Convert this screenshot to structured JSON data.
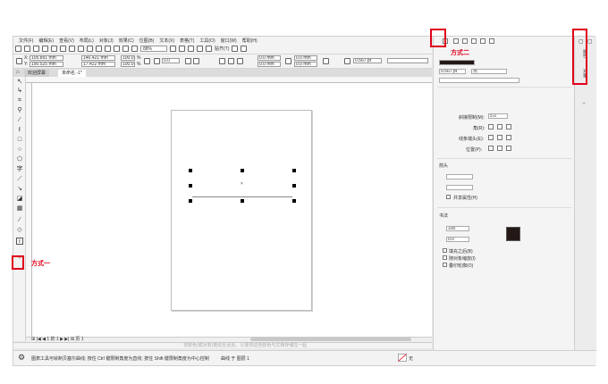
{
  "menu": [
    "文件(F)",
    "编辑(E)",
    "查看(V)",
    "布局(L)",
    "对象(J)",
    "效果(C)",
    "位图(B)",
    "文本(X)",
    "表格(T)",
    "工具(O)",
    "窗口(W)",
    "帮助(H)"
  ],
  "toolbar": {
    "zoom_value": "88%",
    "snap_label": "贴齐(T)"
  },
  "propbar": {
    "x_label": "X:",
    "x_value": "105.891 mm",
    "y_label": "Y:",
    "y_value": "190.525 mm",
    "w_value": "146.421 mm",
    "h_value": "17.422 mm",
    "sx_value": "100.0",
    "sy_value": "100.0",
    "pct": "%",
    "rotation": "0.0",
    "pos1": "0.0 mm",
    "pos2": "0.0 mm",
    "outline1": "0.0 mm",
    "outline2": "0.0 mm",
    "stroke": "0.567 pt"
  },
  "tabs": {
    "welcome": "欢迎屏幕",
    "doc": "未命名 -1*"
  },
  "pagenav": {
    "page_label": "页 1"
  },
  "palette_hint": "将颜色(或对象)拖动至此处，以便将这些颜色与文档存储在一起",
  "status": {
    "text": "图表工具可绘制贝塞尔曲线; 按住 Ctrl 键限制角度为直线; 按住 Shift 键限制角度为中心控制",
    "layer": "曲线 于 图层 1",
    "fill_none": "无"
  },
  "docker": {
    "stroke_width": "0.567 pt",
    "unit": "点",
    "miter_label": "斜接限制(M):",
    "miter_value": "5.0",
    "corner_label": "角(R):",
    "cap_label": "线条端头(E):",
    "pos_label": "位置(P):",
    "arrow_section": "箭头",
    "share_attr": "共享属性(H)",
    "calligraphy": "书法",
    "spread_value": "100",
    "angle_value": "0.0",
    "fill_behind": "填充之后(B)",
    "scale_with_image": "随对象缩放(I)",
    "overprint": "叠印轮廓(O)"
  },
  "side_tabs": [
    "属性",
    "对象"
  ],
  "annotations": {
    "method1": "方式一",
    "method2": "方式二"
  },
  "colors": {
    "annotation_red": "#e0001b",
    "swatch": "#231815"
  }
}
